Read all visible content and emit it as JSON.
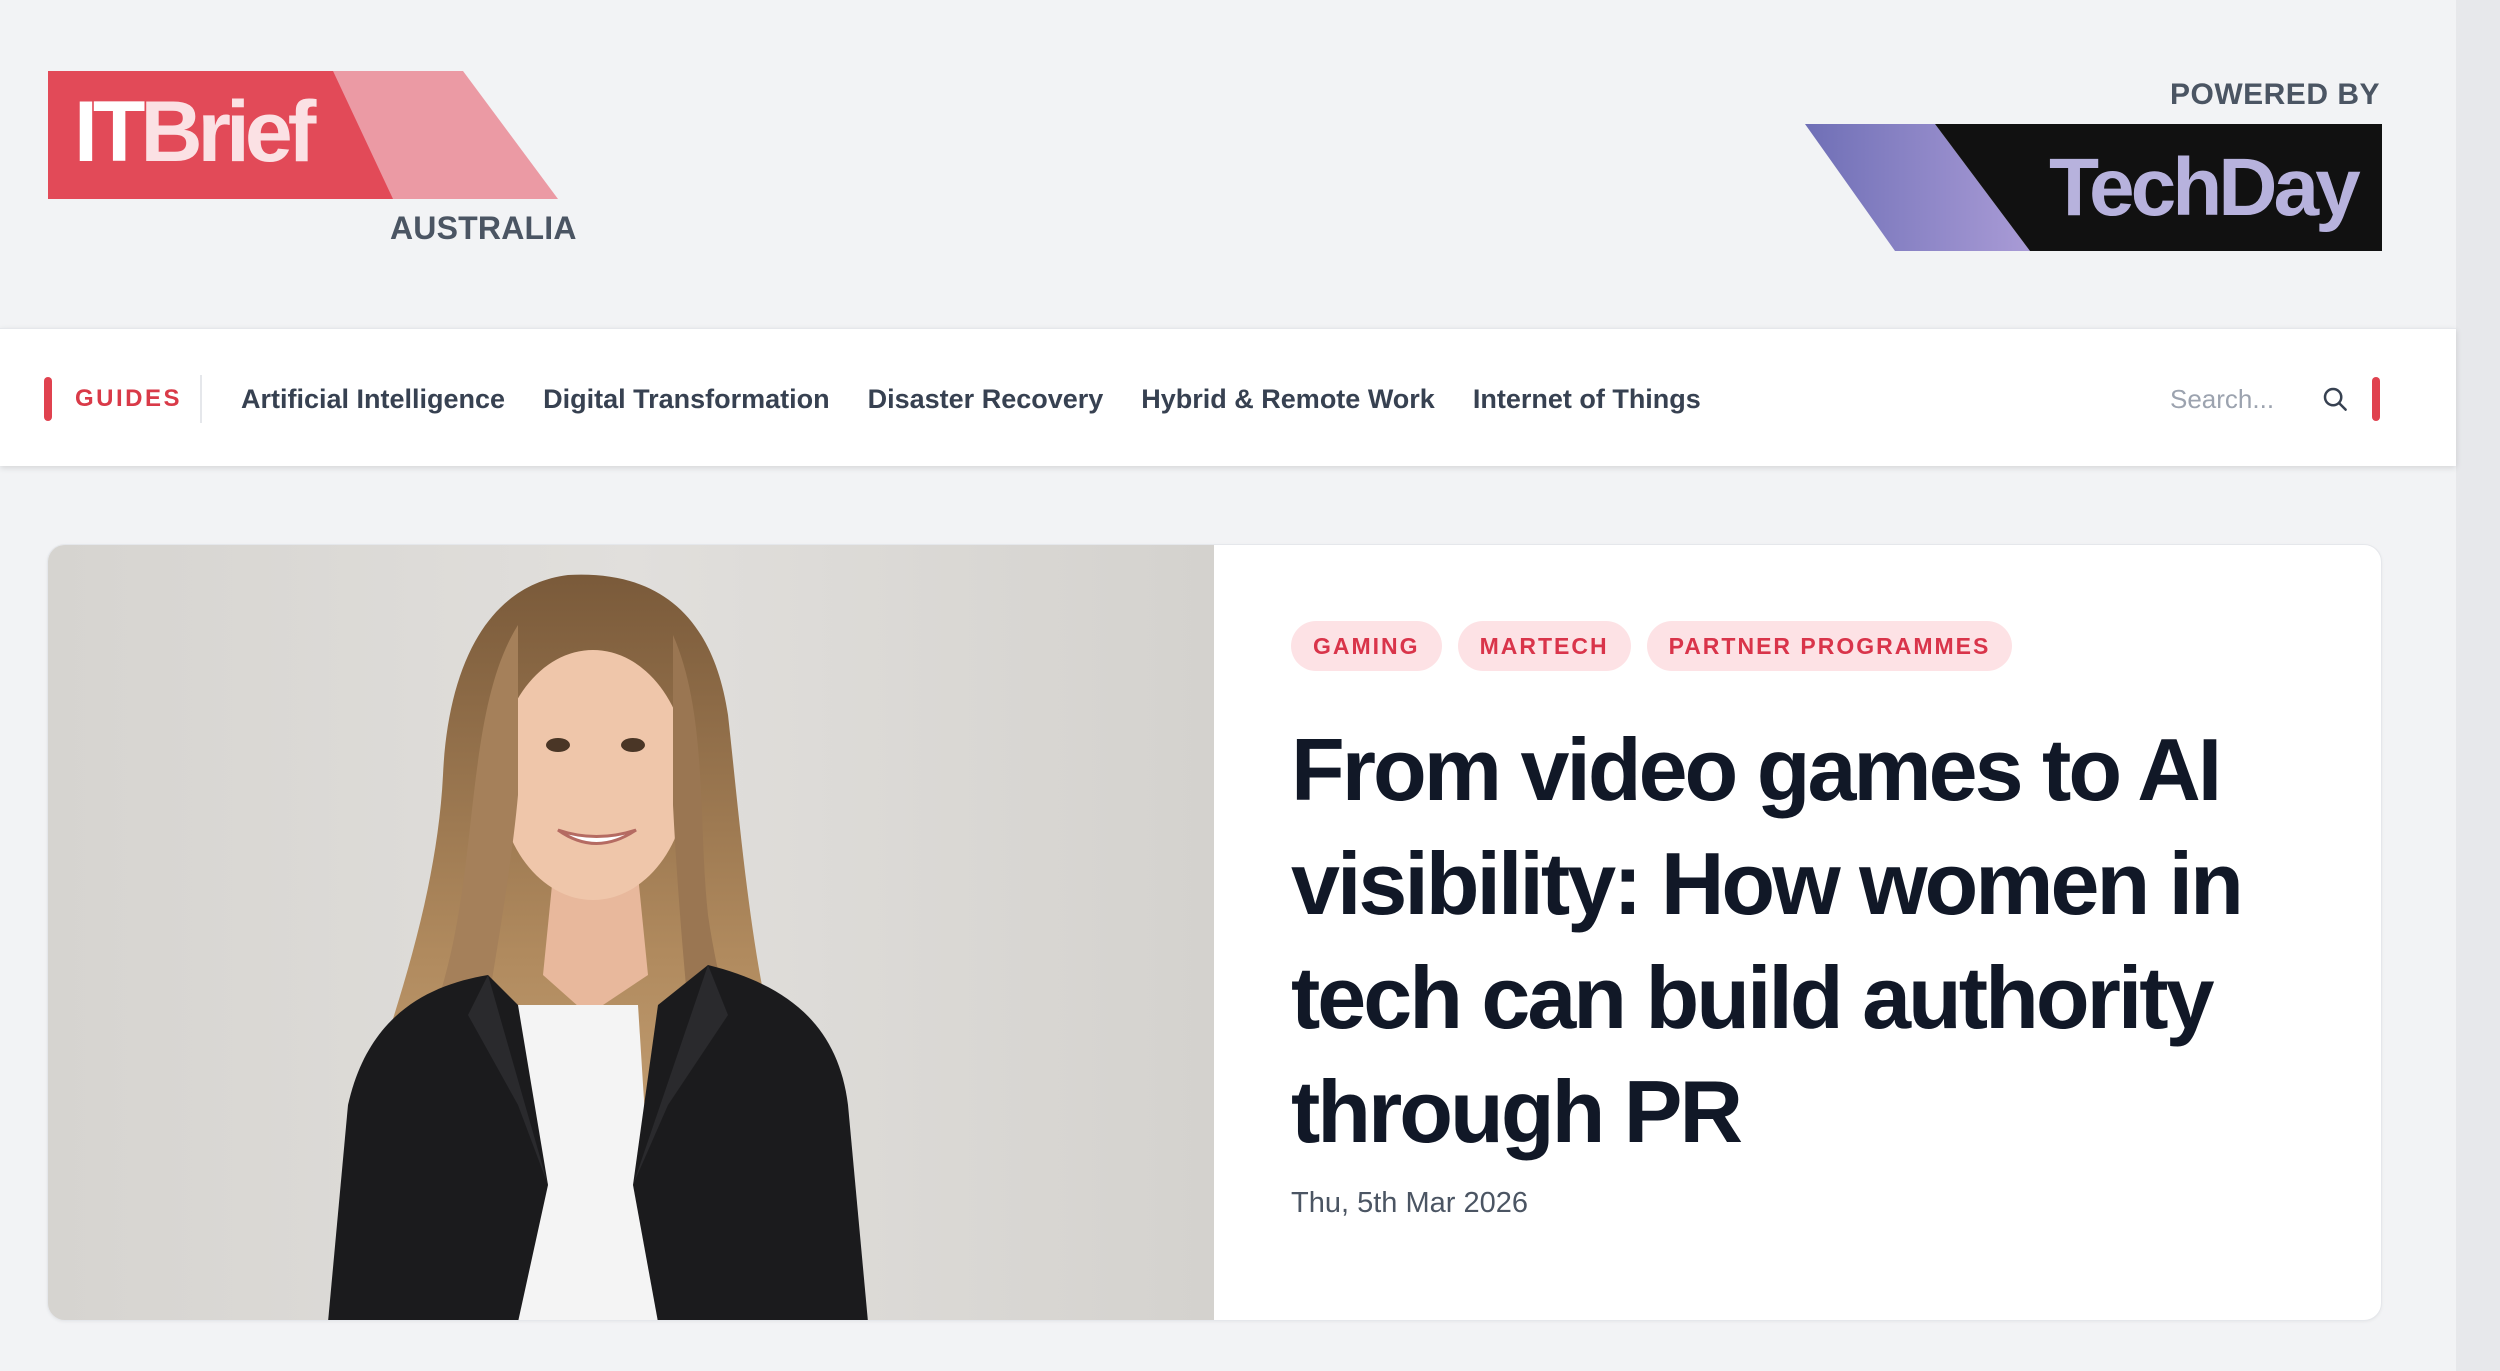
{
  "header": {
    "logo_left": {
      "text_it": "IT",
      "text_brief": "Brief",
      "region": "AUSTRALIA"
    },
    "powered_by": "POWERED BY",
    "logo_right": {
      "text": "TechDay"
    }
  },
  "nav": {
    "guides_label": "GUIDES",
    "links": [
      "Artificial Intelligence",
      "Digital Transformation",
      "Disaster Recovery",
      "Hybrid & Remote Work",
      "Internet of Things"
    ],
    "search_placeholder": "Search..."
  },
  "featured": {
    "tags": [
      "GAMING",
      "MARTECH",
      "PARTNER PROGRAMMES"
    ],
    "headline": "From video games to AI visibility: How women in tech can build authority through PR",
    "date": "Thu, 5th Mar 2026"
  },
  "colors": {
    "accent": "#e0424f",
    "tag_bg": "#fde2e5",
    "tag_text": "#d9344a",
    "page_bg": "#f2f3f5"
  },
  "icons": {
    "search": "search-icon"
  }
}
